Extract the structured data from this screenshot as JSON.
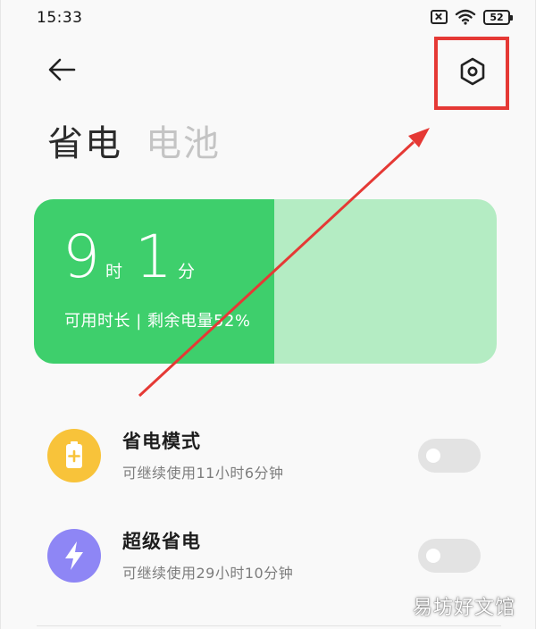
{
  "status_bar": {
    "time": "15:33",
    "battery_level": "52",
    "icons": [
      "sim-off-icon",
      "wifi-icon",
      "battery-icon"
    ]
  },
  "header": {
    "back_icon": "arrow-left-icon",
    "settings_icon": "hexagon-settings-icon"
  },
  "tabs": [
    {
      "label": "省电",
      "active": true
    },
    {
      "label": "电池",
      "active": false
    }
  ],
  "battery_card": {
    "hours": "9",
    "hours_unit": "时",
    "minutes": "1",
    "minutes_unit": "分",
    "subtitle": "可用时长 | 剩余电量52%",
    "remaining_fraction": 0.52,
    "fill_color": "#3ecf6c",
    "track_color": "#b4ecc3"
  },
  "modes": [
    {
      "title": "省电模式",
      "description": "可继续使用11小时6分钟",
      "icon": "battery-plus-icon",
      "icon_color": "#f8c33a",
      "enabled": false
    },
    {
      "title": "超级省电",
      "description": "可继续使用29小时10分钟",
      "icon": "lightning-icon",
      "icon_color": "#8e86f5",
      "enabled": false
    }
  ],
  "annotation": {
    "color": "#e53935"
  },
  "watermark": "易坊好文馆"
}
